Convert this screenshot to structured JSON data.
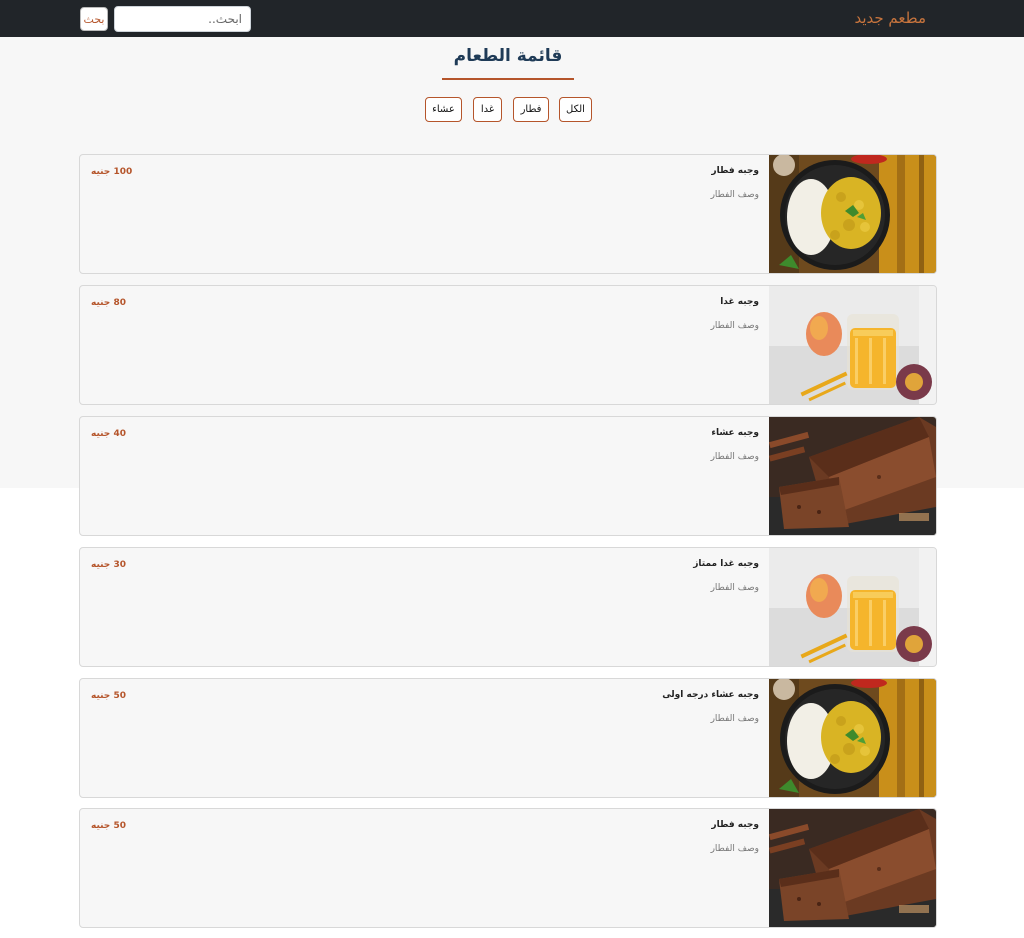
{
  "navbar": {
    "brand": "مطعم جديد",
    "search_placeholder": "ابحث..",
    "search_button": "بحث"
  },
  "page_title": "قائمة الطعام",
  "filters": [
    "الكل",
    "فطار",
    "غدا",
    "عشاء"
  ],
  "colors": {
    "accent": "#b5552b",
    "brand": "#c7743d",
    "navbar": "#212529",
    "title": "#1f3b57",
    "card_bg": "#f7f7f7"
  },
  "menu_items": [
    {
      "name": "وجبه فطار",
      "description": "وصف الفطار",
      "price": "100 جنيه",
      "image": "curry-rice-plate"
    },
    {
      "name": "وجبه غدا",
      "description": "وصف الفطار",
      "price": "80 جنيه",
      "image": "mango-juice-glass"
    },
    {
      "name": "وجبه عشاء",
      "description": "وصف الفطار",
      "price": "40 جنيه",
      "image": "chocolate-loaf-cake"
    },
    {
      "name": "وجبه غدا ممتاز",
      "description": "وصف الفطار",
      "price": "30 جنيه",
      "image": "mango-juice-glass"
    },
    {
      "name": "وجبه عشاء درجه اولى",
      "description": "وصف الفطار",
      "price": "50 جنيه",
      "image": "curry-rice-plate"
    },
    {
      "name": "وجبه فطار",
      "description": "وصف الفطار",
      "price": "50 جنيه",
      "image": "chocolate-loaf-cake"
    }
  ]
}
